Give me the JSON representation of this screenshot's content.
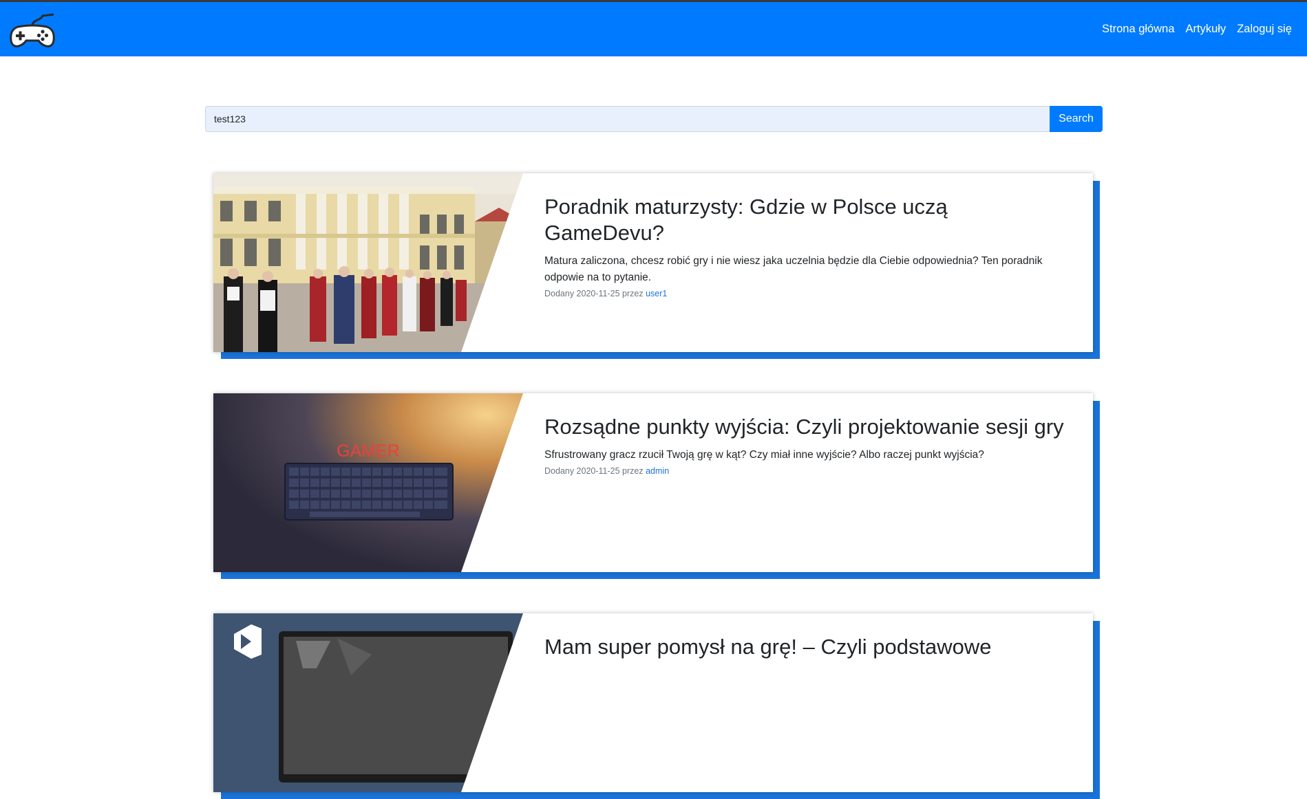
{
  "navbar": {
    "logo_icon": "gamepad-icon",
    "links": [
      "Strona główna",
      "Artykuły",
      "Zaloguj się"
    ],
    "bg_color": "#007bff"
  },
  "search": {
    "value": "test123",
    "button_label": "Search"
  },
  "articles": [
    {
      "title": "Poradnik maturzysty: Gdzie w Polsce uczą GameDevu?",
      "description": "Matura zaliczona, chcesz robić gry i nie wiesz jaka uczelnia będzie dla Ciebie odpowiednia? Ten poradnik odpowie na to pytanie.",
      "meta_prefix": "Dodany 2020-11-25 przez",
      "author": "user1",
      "image_icon": "university-procession-image"
    },
    {
      "title": "Rozsądne punkty wyjścia: Czyli projektowanie sesji gry",
      "description": "Sfrustrowany gracz rzucił Twoją grę w kąt? Czy miał inne wyjście? Albo raczej punkt wyjścia?",
      "meta_prefix": "Dodany 2020-11-25 przez",
      "author": "admin",
      "image_icon": "gamer-keyboard-image",
      "image_text": "GAMER"
    },
    {
      "title": "Mam super pomysł na grę! – Czyli podstawowe",
      "description": "",
      "meta_prefix": "",
      "author": "",
      "image_icon": "visual-studio-image"
    }
  ]
}
